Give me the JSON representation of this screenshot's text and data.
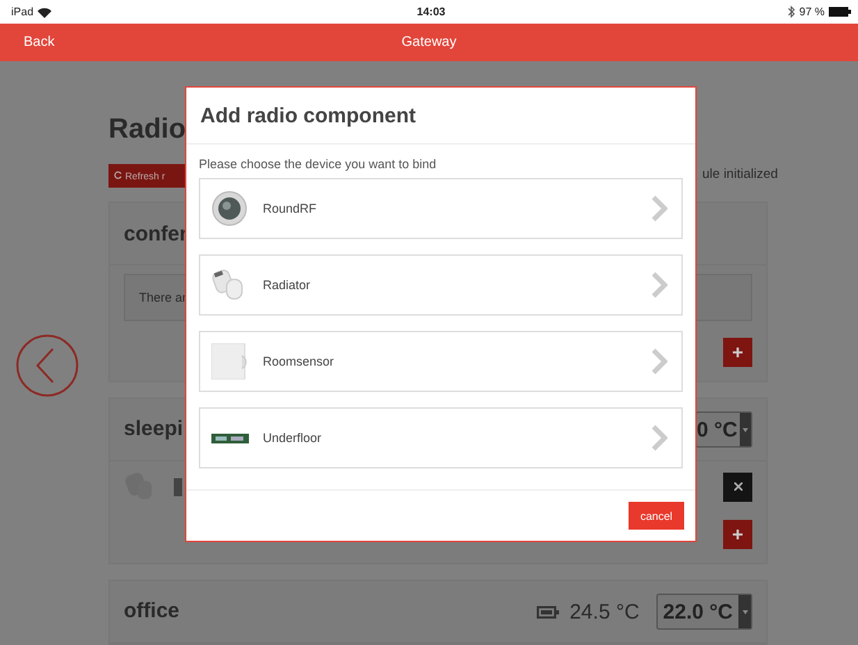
{
  "status_bar": {
    "device": "iPad",
    "time": "14:03",
    "battery": "97 %"
  },
  "nav": {
    "back": "Back",
    "title": "Gateway"
  },
  "page": {
    "title": "Radio",
    "refresh": "Refresh r",
    "status": "ule initialized",
    "rooms": [
      {
        "kind": "empty",
        "name": "confer",
        "message": "There ar"
      },
      {
        "kind": "devices",
        "name": "sleepi",
        "setpoint": "0 °C"
      },
      {
        "kind": "header",
        "name": "office",
        "temperature": "24.5 °C",
        "setpoint": "22.0 °C"
      }
    ]
  },
  "dialog": {
    "title": "Add radio component",
    "prompt": "Please choose the device you want to bind",
    "devices": [
      {
        "kind": "round",
        "name": "RoundRF"
      },
      {
        "kind": "radiator",
        "name": "Radiator"
      },
      {
        "kind": "sensor",
        "name": "Roomsensor"
      },
      {
        "kind": "floor",
        "name": "Underfloor"
      }
    ],
    "cancel": "cancel"
  }
}
